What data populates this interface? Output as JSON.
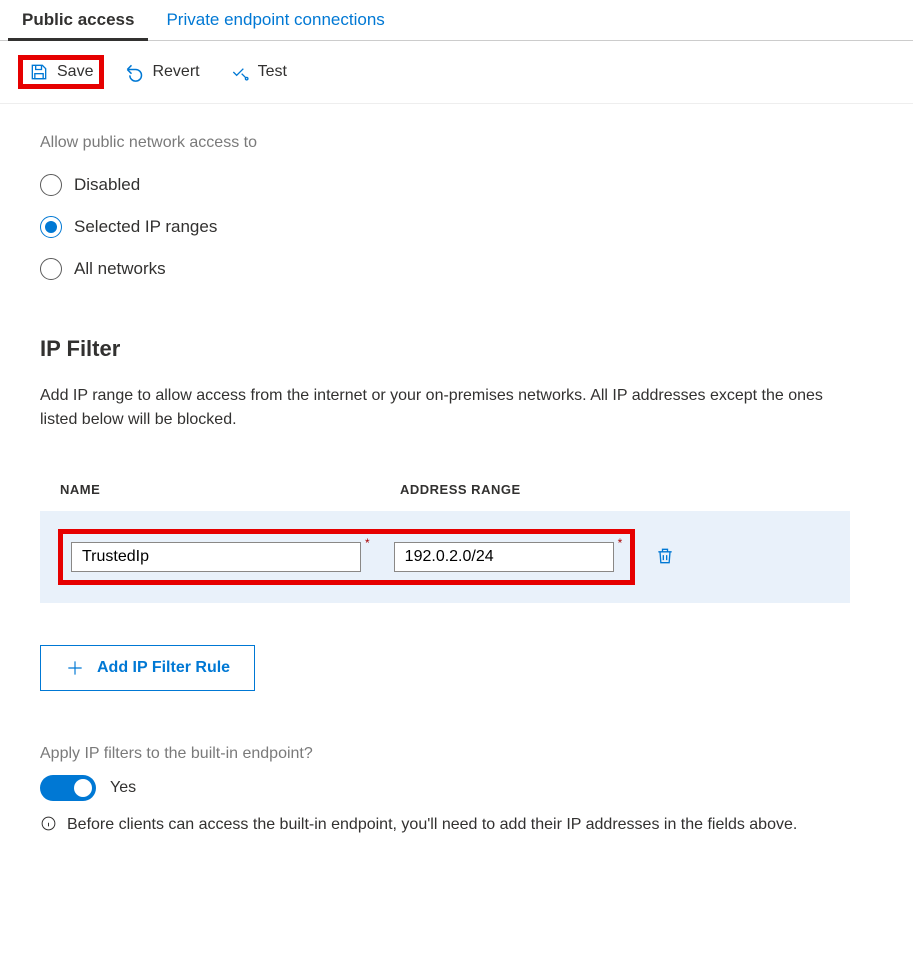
{
  "tabs": {
    "public": "Public access",
    "private": "Private endpoint connections"
  },
  "toolbar": {
    "save_label": "Save",
    "revert_label": "Revert",
    "test_label": "Test"
  },
  "access": {
    "heading": "Allow public network access to",
    "options": {
      "disabled": "Disabled",
      "selected_ranges": "Selected IP ranges",
      "all": "All networks"
    }
  },
  "ip_filter": {
    "heading": "IP Filter",
    "description": "Add IP range to allow access from the internet or your on-premises networks. All IP addresses except the ones listed below will be blocked.",
    "columns": {
      "name": "NAME",
      "range": "ADDRESS RANGE"
    },
    "rows": [
      {
        "name": "TrustedIp",
        "range": "192.0.2.0/24"
      }
    ],
    "add_button": "Add IP Filter Rule"
  },
  "builtin": {
    "question": "Apply IP filters to the built-in endpoint?",
    "toggle_label": "Yes",
    "info": "Before clients can access the built-in endpoint, you'll need to add their IP addresses in the fields above."
  }
}
